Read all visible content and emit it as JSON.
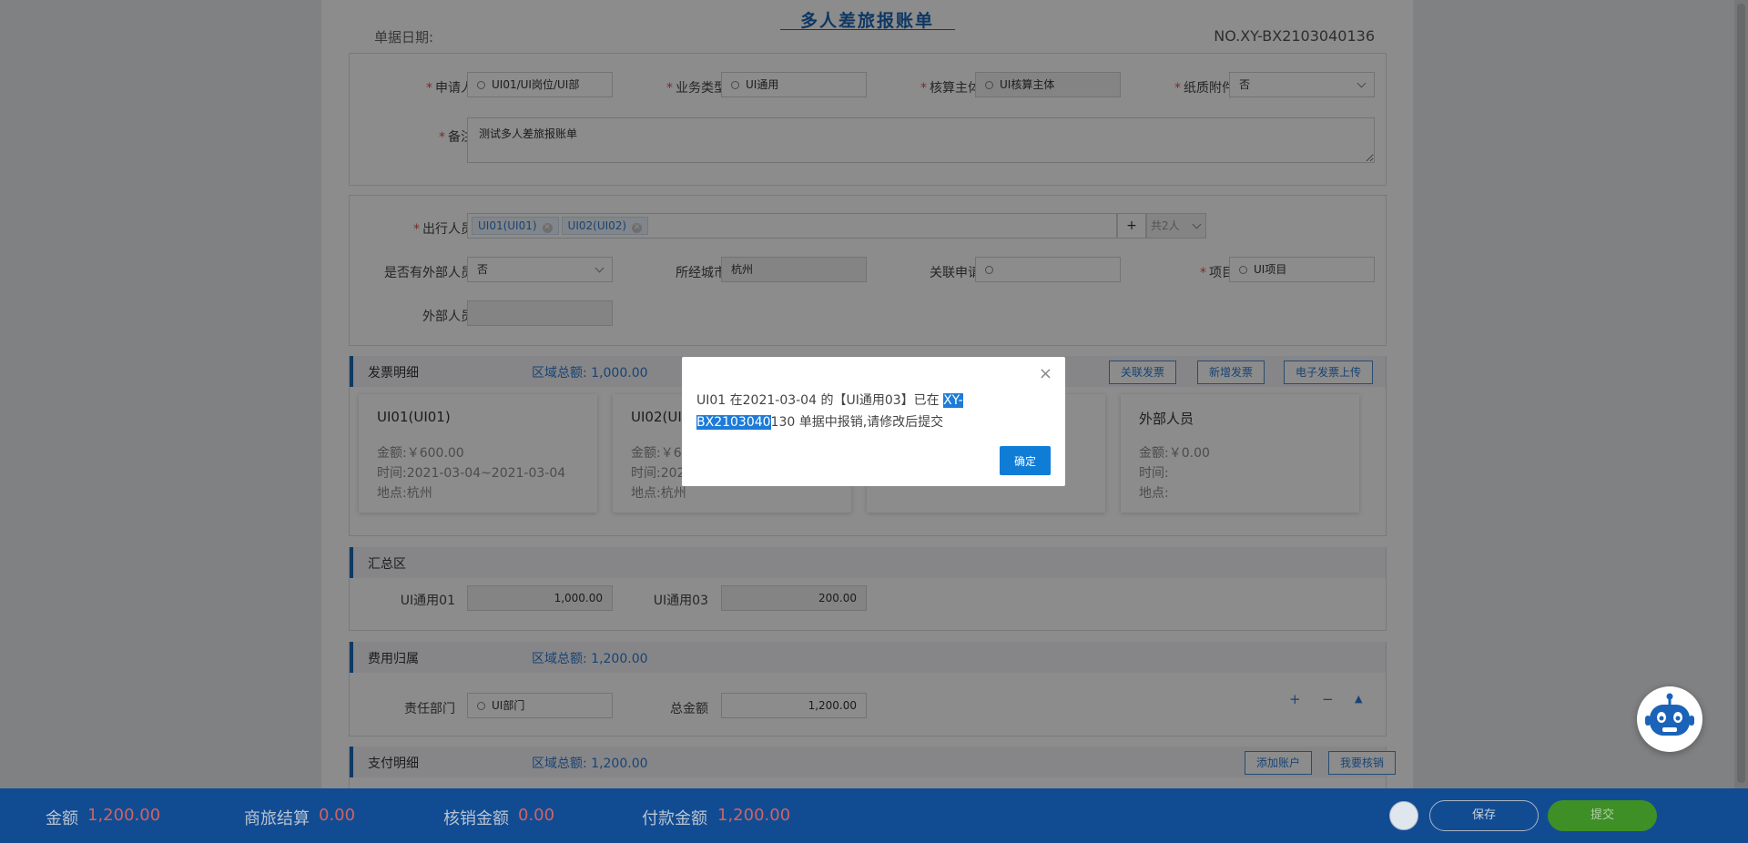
{
  "header": {
    "title": "多人差旅报账单",
    "date_label": "单据日期:",
    "doc_no": "NO.XY-BX2103040136"
  },
  "basic": {
    "applicant": {
      "label": "申请人",
      "value": "UI01/UI岗位/UI部"
    },
    "biz_type": {
      "label": "业务类型",
      "value": "UI通用"
    },
    "entity": {
      "label": "核算主体",
      "value": "UI核算主体"
    },
    "paper": {
      "label": "纸质附件",
      "value": "否"
    },
    "memo": {
      "label": "备注",
      "value": "测试多人差旅报账单"
    }
  },
  "travel": {
    "travelers_label": "出行人员",
    "travelers": [
      "UI01(UI01)",
      "UI02(UI02)"
    ],
    "plus": "+",
    "count": "共2人",
    "external_flag": {
      "label": "是否有外部人员",
      "value": "否"
    },
    "city": {
      "label": "所经城市",
      "value": "杭州"
    },
    "related_apply": {
      "label": "关联申请",
      "value": ""
    },
    "project": {
      "label": "项目",
      "value": "UI项目"
    },
    "external_person": {
      "label": "外部人员",
      "value": ""
    }
  },
  "invoice": {
    "title": "发票明细",
    "total_label": "区域总额:",
    "total": "1,000.00",
    "buttons": [
      "关联发票",
      "新增发票",
      "电子发票上传"
    ],
    "cards": [
      {
        "name": "UI01(UI01)",
        "amount": "金额:￥600.00",
        "time": "时间:2021-03-04~2021-03-04",
        "place": "地点:杭州"
      },
      {
        "name": "UI02(UI0",
        "amount": "金额:￥60",
        "time": "时间:202",
        "place": "地点:杭州"
      },
      {
        "name": "外部人员",
        "amount": "金额:￥0.00",
        "time": "时间:",
        "place": "地点:"
      }
    ]
  },
  "summary": {
    "title": "汇总区",
    "items": [
      {
        "label": "UI通用01",
        "value": "1,000.00"
      },
      {
        "label": "UI通用03",
        "value": "200.00"
      }
    ]
  },
  "cost": {
    "title": "费用归属",
    "total_label": "区域总额:",
    "total": "1,200.00",
    "dept": {
      "label": "责任部门",
      "value": "UI部门"
    },
    "amount": {
      "label": "总金额",
      "value": "1,200.00"
    },
    "controls": [
      "+",
      "−",
      "▲"
    ]
  },
  "payment": {
    "title": "支付明细",
    "total_label": "区域总额:",
    "total": "1,200.00",
    "buttons": [
      "添加账户",
      "我要核销"
    ]
  },
  "dialog": {
    "close": "×",
    "msg_pre": "UI01 在2021-03-04 的【UI通用03】已在 ",
    "msg_highlight": "XY-BX2103040",
    "msg_post": "130 单据中报销,请修改后提交",
    "ok": "确定"
  },
  "footer": {
    "amount_label": "金额",
    "amount": "1,200.00",
    "biz_label": "商旅结算",
    "biz": "0.00",
    "writeoff_label": "核销金额",
    "writeoff": "0.00",
    "pay_label": "付款金额",
    "pay": "1,200.00",
    "save": "保存",
    "submit": "提交"
  },
  "colors": {
    "accent": "#1d68b4",
    "footer": "#114c93",
    "submit": "#3e8f26",
    "amount_red": "#d26262"
  }
}
